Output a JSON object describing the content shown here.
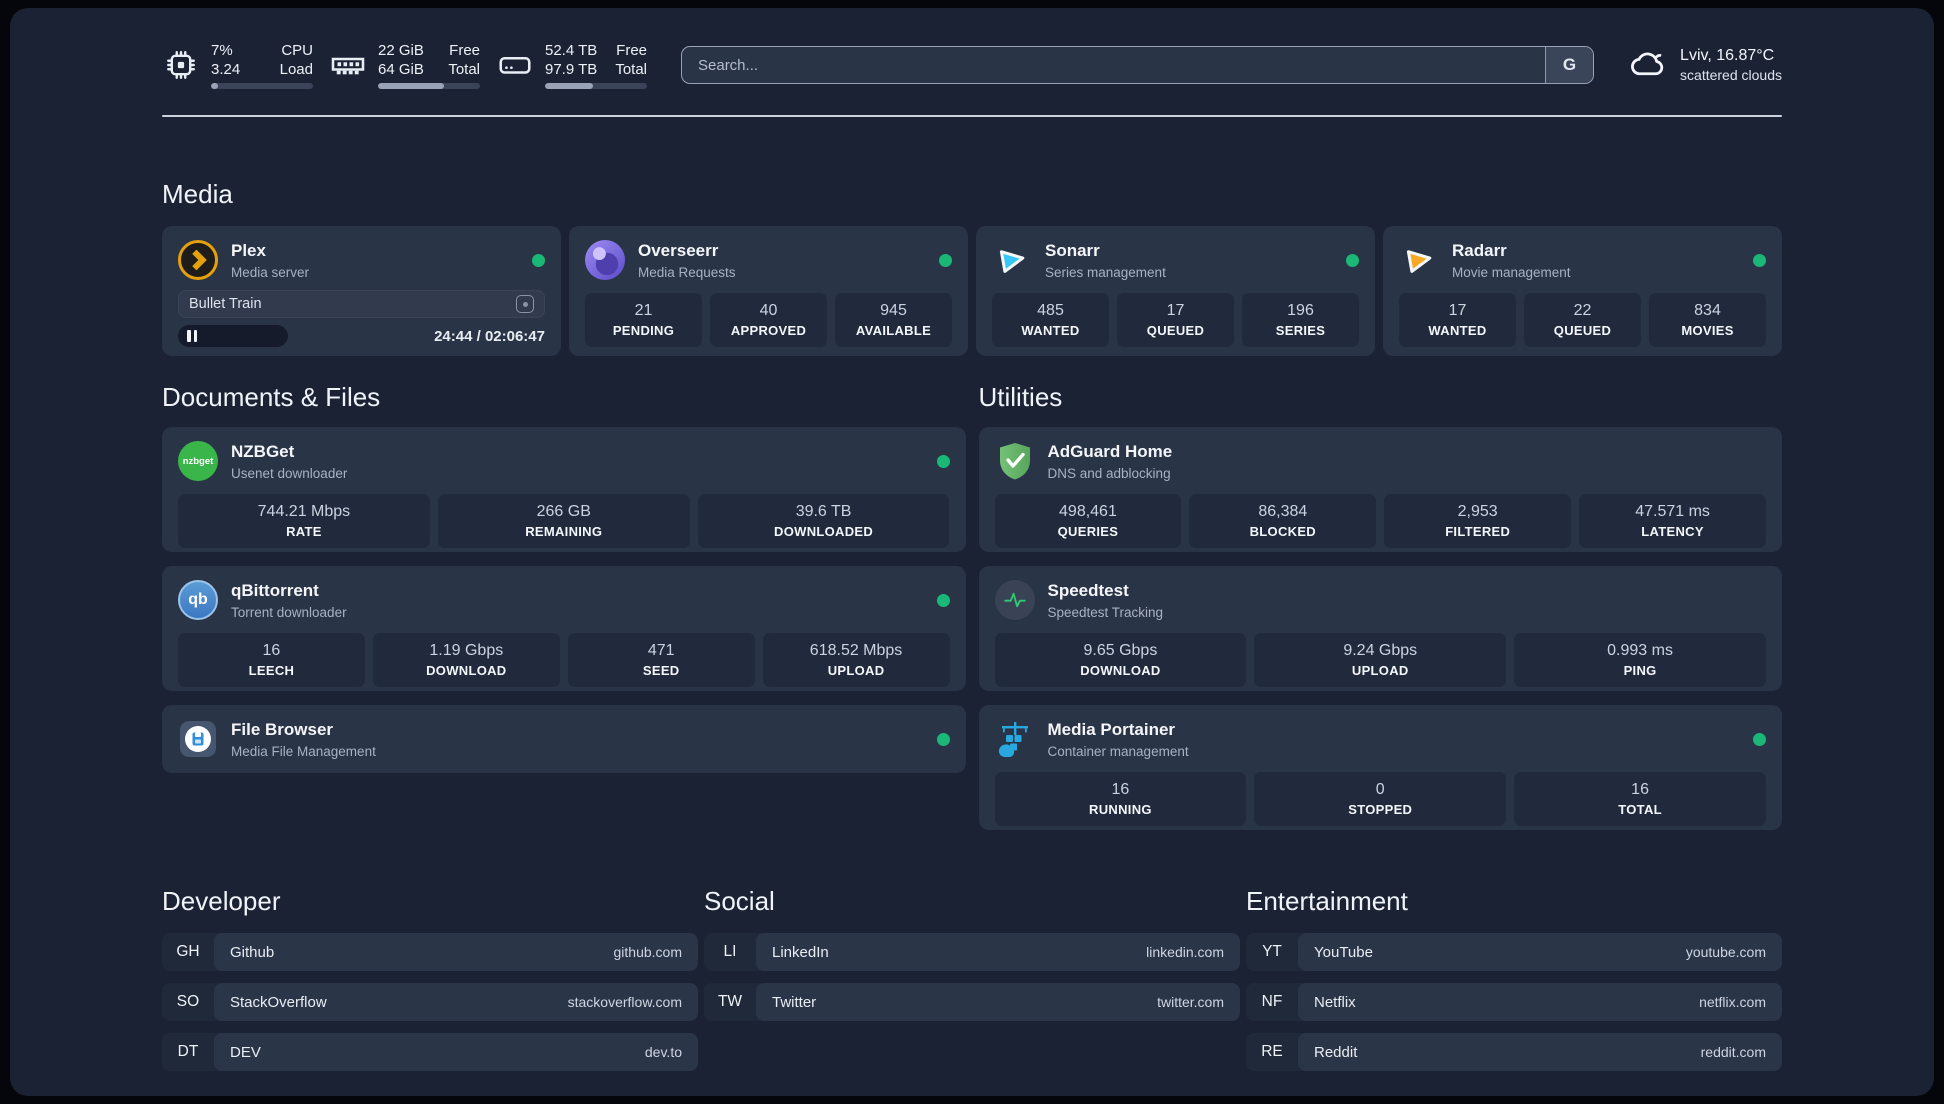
{
  "colors": {
    "page_bg": "#1b2234",
    "card_bg": "#2a3447",
    "tile_bg": "#212a3c",
    "status_online": "#19b877",
    "progress_fill": "#9aa3b5",
    "plex_gold": "#e5a00d",
    "sonarr_blue": "#38c6f4",
    "radarr_orange": "#f9a825",
    "nzbget_green": "#3ab54a",
    "qbittorrent_blue": "#4a8fd4",
    "adguard_green": "#68b36b",
    "speedtest_green": "#2ecc71",
    "portainer_blue": "#29a8df",
    "overseerr_purple": "#7b6ce0"
  },
  "header": {
    "stats": [
      {
        "icon": "cpu-icon",
        "value_top": "7%",
        "value_bottom": "3.24",
        "label_top": "CPU",
        "label_bottom": "Load",
        "progress": 7
      },
      {
        "icon": "ram-icon",
        "value_top": "22 GiB",
        "value_bottom": "64 GiB",
        "label_top": "Free",
        "label_bottom": "Total",
        "progress": 65
      },
      {
        "icon": "disk-icon",
        "value_top": "52.4 TB",
        "value_bottom": "97.9 TB",
        "label_top": "Free",
        "label_bottom": "Total",
        "progress": 47
      }
    ],
    "search": {
      "placeholder": "Search...",
      "engine_label": "G"
    },
    "weather": {
      "location_temp": "Lviv, 16.87°C",
      "condition": "scattered clouds"
    }
  },
  "section_titles": {
    "media": "Media",
    "documents": "Documents & Files",
    "utilities": "Utilities"
  },
  "services": {
    "plex": {
      "name": "Plex",
      "description": "Media server",
      "online": true,
      "now_playing": {
        "title": "Bullet Train",
        "state": "paused",
        "time_display": "24:44 / 02:06:47"
      }
    },
    "overseerr": {
      "name": "Overseerr",
      "description": "Media Requests",
      "online": true,
      "stats": [
        {
          "value": "21",
          "label": "PENDING"
        },
        {
          "value": "40",
          "label": "APPROVED"
        },
        {
          "value": "945",
          "label": "AVAILABLE"
        }
      ]
    },
    "sonarr": {
      "name": "Sonarr",
      "description": "Series management",
      "online": true,
      "stats": [
        {
          "value": "485",
          "label": "WANTED"
        },
        {
          "value": "17",
          "label": "QUEUED"
        },
        {
          "value": "196",
          "label": "SERIES"
        }
      ]
    },
    "radarr": {
      "name": "Radarr",
      "description": "Movie management",
      "online": true,
      "stats": [
        {
          "value": "17",
          "label": "WANTED"
        },
        {
          "value": "22",
          "label": "QUEUED"
        },
        {
          "value": "834",
          "label": "MOVIES"
        }
      ]
    },
    "nzbget": {
      "name": "NZBGet",
      "description": "Usenet downloader",
      "online": true,
      "stats": [
        {
          "value": "744.21 Mbps",
          "label": "RATE"
        },
        {
          "value": "266 GB",
          "label": "REMAINING"
        },
        {
          "value": "39.6 TB",
          "label": "DOWNLOADED"
        }
      ]
    },
    "qbittorrent": {
      "name": "qBittorrent",
      "description": "Torrent downloader",
      "online": true,
      "stats": [
        {
          "value": "16",
          "label": "LEECH"
        },
        {
          "value": "1.19 Gbps",
          "label": "DOWNLOAD"
        },
        {
          "value": "471",
          "label": "SEED"
        },
        {
          "value": "618.52 Mbps",
          "label": "UPLOAD"
        }
      ]
    },
    "filebrowser": {
      "name": "File Browser",
      "description": "Media File Management",
      "online": true
    },
    "adguard": {
      "name": "AdGuard Home",
      "description": "DNS and adblocking",
      "online": false,
      "stats": [
        {
          "value": "498,461",
          "label": "QUERIES"
        },
        {
          "value": "86,384",
          "label": "BLOCKED"
        },
        {
          "value": "2,953",
          "label": "FILTERED"
        },
        {
          "value": "47.571 ms",
          "label": "LATENCY"
        }
      ]
    },
    "speedtest": {
      "name": "Speedtest",
      "description": "Speedtest Tracking",
      "online": false,
      "stats": [
        {
          "value": "9.65 Gbps",
          "label": "DOWNLOAD"
        },
        {
          "value": "9.24 Gbps",
          "label": "UPLOAD"
        },
        {
          "value": "0.993 ms",
          "label": "PING"
        }
      ]
    },
    "portainer": {
      "name": "Media Portainer",
      "description": "Container management",
      "online": true,
      "stats": [
        {
          "value": "16",
          "label": "RUNNING"
        },
        {
          "value": "0",
          "label": "STOPPED"
        },
        {
          "value": "16",
          "label": "TOTAL"
        }
      ]
    }
  },
  "bookmark_groups": [
    {
      "title": "Developer",
      "links": [
        {
          "abbr": "GH",
          "name": "Github",
          "domain": "github.com"
        },
        {
          "abbr": "SO",
          "name": "StackOverflow",
          "domain": "stackoverflow.com"
        },
        {
          "abbr": "DT",
          "name": "DEV",
          "domain": "dev.to"
        }
      ]
    },
    {
      "title": "Social",
      "links": [
        {
          "abbr": "LI",
          "name": "LinkedIn",
          "domain": "linkedin.com"
        },
        {
          "abbr": "TW",
          "name": "Twitter",
          "domain": "twitter.com"
        }
      ]
    },
    {
      "title": "Entertainment",
      "links": [
        {
          "abbr": "YT",
          "name": "YouTube",
          "domain": "youtube.com"
        },
        {
          "abbr": "NF",
          "name": "Netflix",
          "domain": "netflix.com"
        },
        {
          "abbr": "RE",
          "name": "Reddit",
          "domain": "reddit.com"
        }
      ]
    }
  ]
}
